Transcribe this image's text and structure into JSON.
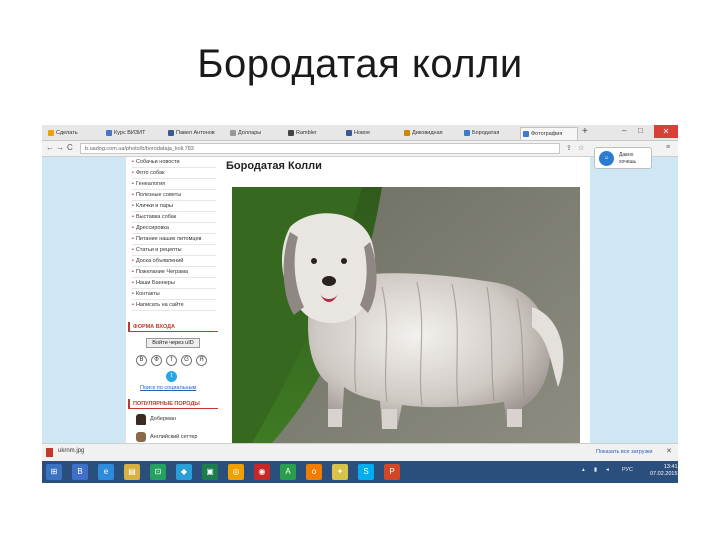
{
  "slide": {
    "title": "Бородатая колли"
  },
  "browser": {
    "tabs": [
      {
        "label": "Сделать",
        "color": "#f0a000"
      },
      {
        "label": "Курс ВИЗИТ",
        "color": "#4a76c8"
      },
      {
        "label": "Павел Антонов",
        "color": "#3b5998"
      },
      {
        "label": "Доллары",
        "color": "#999999"
      },
      {
        "label": "Rambler",
        "color": "#444444"
      },
      {
        "label": "Новое",
        "color": "#3b5998"
      },
      {
        "label": "Диковидная",
        "color": "#cc8800"
      },
      {
        "label": "Бородатая",
        "color": "#3b7bd1"
      },
      {
        "label": "Фотография",
        "color": "#3b7bd1"
      }
    ],
    "new_tab": "+",
    "minimize": "–",
    "maximize": "□",
    "close": "✕",
    "back": "←",
    "forward": "→",
    "reload": "C",
    "url": "b.uadog.com.ua/photo/b/borodataja_koli.783",
    "popup": {
      "avatar": "☺",
      "line1": "Давно",
      "line2": "хочешь"
    }
  },
  "page": {
    "title": "Бородатая Колли",
    "menu": [
      "Собачьи новости",
      "Фото собак",
      "Генеалогия",
      "Полезные советы",
      "Клички и пары",
      "Выставка собак",
      "Дрессировка",
      "Питание наших питомцев",
      "Статьи и рецепты",
      "Доска объявлений",
      "Пожелание Чеграма",
      "Наши Баннеры",
      "Контакты",
      "Написать на сайте"
    ],
    "login_head": "ФОРМА ВХОДА",
    "login_button": "Войти через uID",
    "social_icons": [
      "В",
      "Ф",
      "f",
      "G",
      "Я"
    ],
    "twitter_icon": "t",
    "social_link": "Поиск по социальным",
    "breeds_head": "ПОПУЛЯРНЫЕ ПОРОДЫ",
    "breeds": [
      {
        "label": "Доберман"
      },
      {
        "label": "Английский сеттер"
      }
    ]
  },
  "download": {
    "file": "ukrnm.jpg",
    "show_all": "Показать все загрузки",
    "close": "✕"
  },
  "taskbar": {
    "apps": [
      {
        "glyph": "⊞",
        "color": "#3c72c2"
      },
      {
        "glyph": "B",
        "color": "#3f6fc9"
      },
      {
        "glyph": "e",
        "color": "#2e8bdc"
      },
      {
        "glyph": "▤",
        "color": "#d8b145"
      },
      {
        "glyph": "⊡",
        "color": "#25a161"
      },
      {
        "glyph": "◆",
        "color": "#2a9fd6"
      },
      {
        "glyph": "▣",
        "color": "#1b7c4e"
      },
      {
        "glyph": "◎",
        "color": "#f0a000"
      },
      {
        "glyph": "◉",
        "color": "#c62828"
      },
      {
        "glyph": "А",
        "color": "#2a9f4b"
      },
      {
        "glyph": "о",
        "color": "#f17c00"
      },
      {
        "glyph": "✦",
        "color": "#d9c24a"
      },
      {
        "glyph": "S",
        "color": "#00aff0"
      },
      {
        "glyph": "P",
        "color": "#d24726"
      }
    ],
    "tray_lang": "РУС",
    "time": "13:41",
    "date": "07.02.2015"
  }
}
